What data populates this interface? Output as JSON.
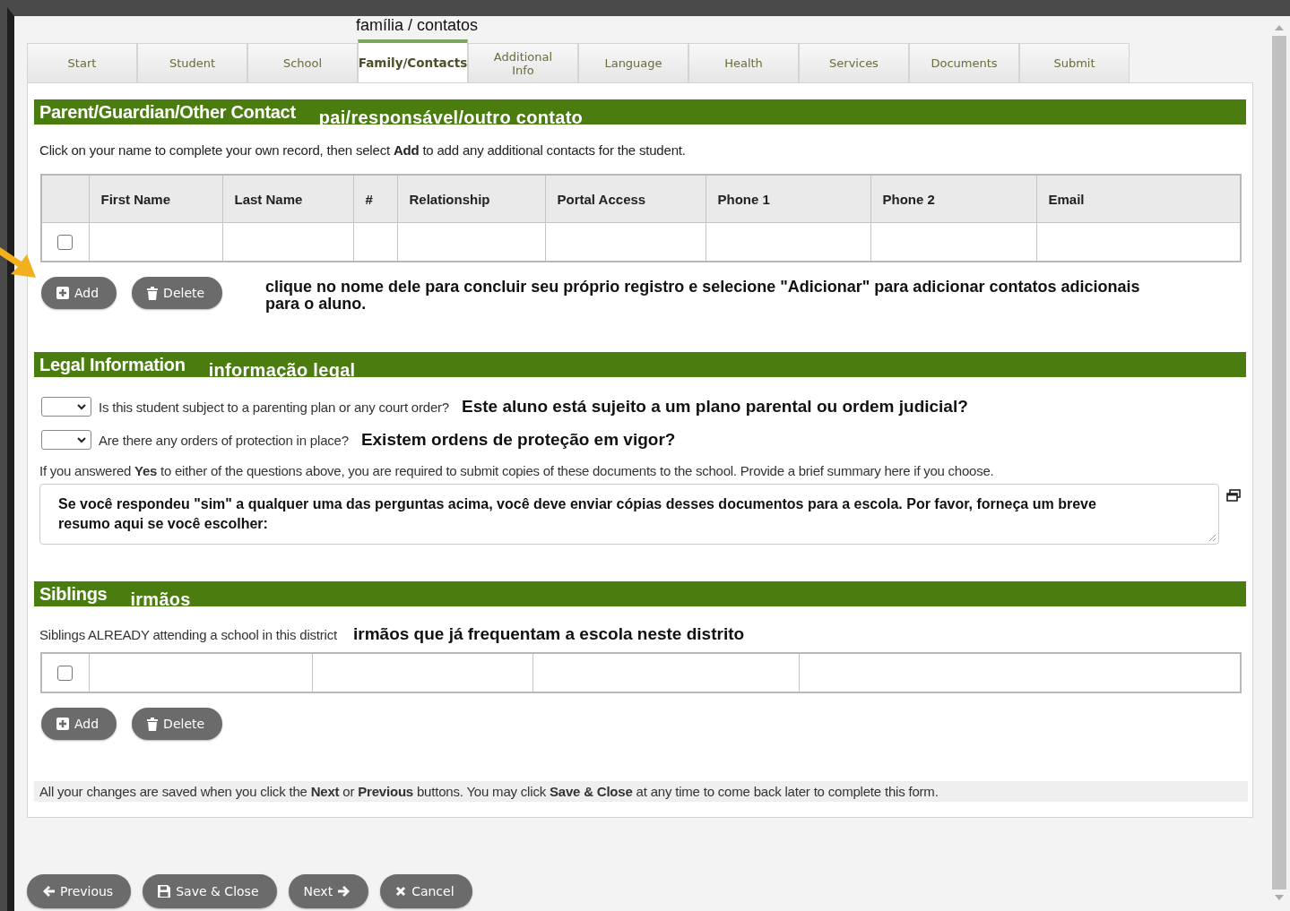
{
  "overlay_tab_label": "família / contatos",
  "tabs": [
    {
      "label": "Start",
      "selected": false
    },
    {
      "label": "Student",
      "selected": false
    },
    {
      "label": "School",
      "selected": false
    },
    {
      "label": "Family/Contacts",
      "selected": true
    },
    {
      "label": "Additional Info",
      "selected": false
    },
    {
      "label": "Language",
      "selected": false
    },
    {
      "label": "Health",
      "selected": false
    },
    {
      "label": "Services",
      "selected": false
    },
    {
      "label": "Documents",
      "selected": false
    },
    {
      "label": "Submit",
      "selected": false
    }
  ],
  "contacts": {
    "title": "Parent/Guardian/Other Contact",
    "translation": "pai/responsável/outro contato",
    "instructions": "Click on your name to complete your own record, then select **Add** to add any additional contacts for the student.",
    "columns": [
      "",
      "First Name",
      "Last Name",
      "#",
      "Relationship",
      "Portal Access",
      "Phone 1",
      "Phone 2",
      "Email"
    ],
    "rows": [
      {
        "checked": false
      }
    ],
    "buttons": [
      {
        "kind": "add",
        "label": "Add"
      },
      {
        "kind": "delete",
        "label": "Delete"
      }
    ],
    "note": "clique no nome dele para concluir seu próprio registro e selecione \"Adicionar\" para adicionar contatos adicionais para o aluno."
  },
  "legal": {
    "title": "Legal Information",
    "translation": "informação legal",
    "questions": [
      {
        "text": "Is this student subject to a parenting plan or any court order?",
        "translation": "Este aluno está sujeito a um plano parental ou ordem judicial?"
      },
      {
        "text": "Are there any orders of protection in place?",
        "translation": "Existem ordens de proteção em vigor?"
      }
    ],
    "note": "If you answered **Yes** to either of the questions above, you are required to submit copies of these documents to the school. Provide a brief summary here if you choose.",
    "summary": "Se você respondeu \"sim\" a qualquer uma das perguntas acima, você deve enviar cópias desses documentos para a escola. Por favor, forneça um breve resumo aqui se você escolher:"
  },
  "siblings": {
    "title": "Siblings",
    "translation": "irmãos",
    "caption": "Siblings ALREADY attending a school in this district",
    "translation_caption": "irmãos que já frequentam a escola neste distrito",
    "rows": [
      {
        "checked": false
      }
    ],
    "buttons": [
      {
        "kind": "add",
        "label": "Add"
      },
      {
        "kind": "delete",
        "label": "Delete"
      }
    ]
  },
  "footer_note": "All your changes are saved when you click the **Next** or **Previous** buttons. You may click **Save & Close** at any time to come back later to complete this form.",
  "nav_buttons": [
    {
      "kind": "previous",
      "label": "Previous"
    },
    {
      "kind": "save",
      "label": "Save & Close"
    },
    {
      "kind": "next",
      "label": "Next"
    },
    {
      "kind": "cancel",
      "label": "Cancel"
    }
  ]
}
